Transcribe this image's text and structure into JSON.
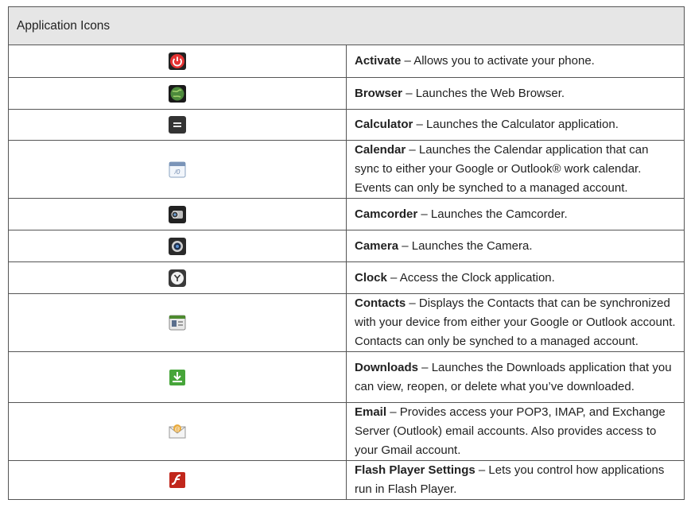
{
  "header": {
    "title": "Application Icons"
  },
  "rows": [
    {
      "icon": "power-icon",
      "name": "Activate",
      "desc": " – Allows you to activate your phone."
    },
    {
      "icon": "globe-icon",
      "name": "Browser",
      "desc": " – Launches the Web Browser."
    },
    {
      "icon": "calculator-icon",
      "name": "Calculator",
      "desc": " – Launches the Calculator application."
    },
    {
      "icon": "calendar-icon",
      "name": "Calendar",
      "desc": " – Launches the Calendar application that can sync to either your Google or Outlook® work calendar. Events can only be synched to a managed account."
    },
    {
      "icon": "camcorder-icon",
      "name": "Camcorder",
      "desc": " – Launches the Camcorder."
    },
    {
      "icon": "camera-icon",
      "name": "Camera",
      "desc": " – Launches the Camera."
    },
    {
      "icon": "clock-icon",
      "name": "Clock",
      "desc": " – Access the Clock application."
    },
    {
      "icon": "contacts-icon",
      "name": "Contacts",
      "desc": " – Displays the Contacts that can be synchronized with your device from either your Google or Outlook account. Contacts can only be synched to a managed account."
    },
    {
      "icon": "download-icon",
      "name": "Downloads",
      "desc": " – Launches the Downloads application that you can view, reopen, or delete what you’ve downloaded."
    },
    {
      "icon": "email-icon",
      "name": "Email",
      "desc": " – Provides access your POP3, IMAP, and Exchange Server (Outlook) email accounts. Also provides access to your Gmail account."
    },
    {
      "icon": "flash-player-icon",
      "name": "Flash Player Settings",
      "desc": " – Lets you control how applications run in Flash Player."
    }
  ]
}
